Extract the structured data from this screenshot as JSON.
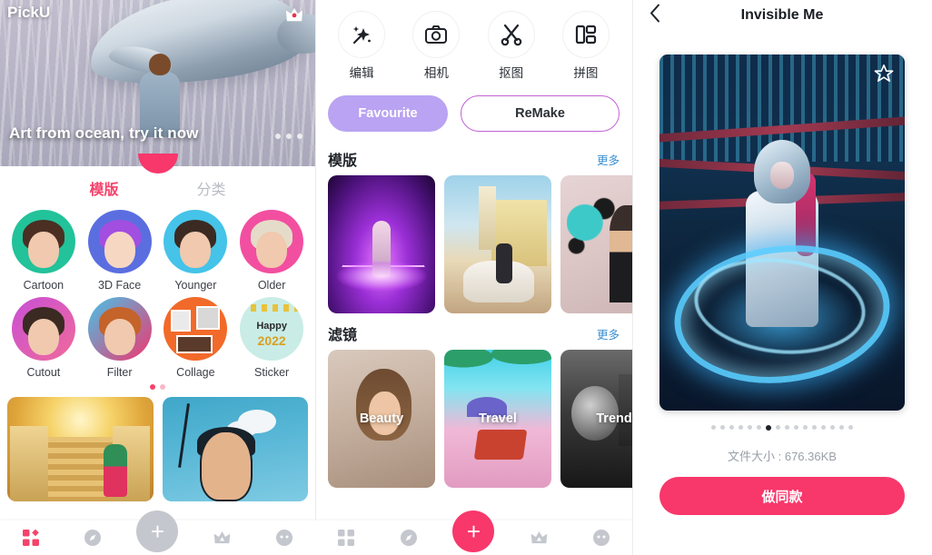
{
  "app": {
    "name": "PickU"
  },
  "left": {
    "logo": "PickU",
    "crown_icon": "crown-icon",
    "banner": {
      "title": "Art from ocean, try it now",
      "dots_count": 3,
      "active_dot": 0
    },
    "tabs": [
      {
        "label": "模版",
        "active": true
      },
      {
        "label": "分类",
        "active": false
      }
    ],
    "categories": [
      {
        "label": "Cartoon",
        "bg": "#22c29a"
      },
      {
        "label": "3D Face",
        "bg": "#5b6ee0"
      },
      {
        "label": "Younger",
        "bg": "#45c3e8"
      },
      {
        "label": "Older",
        "bg": "#f24fa0"
      },
      {
        "label": "Cutout",
        "bg": "#c84fd6"
      },
      {
        "label": "Filter",
        "bg": "#45c3e8"
      },
      {
        "label": "Collage",
        "bg": "#f26a2a"
      },
      {
        "label": "Sticker",
        "bg": "#bfe8e2"
      }
    ],
    "page_dots": {
      "count": 2,
      "active": 0
    },
    "promos": [
      {
        "name": "stairs-temple-template"
      },
      {
        "name": "comic-portrait-template"
      }
    ],
    "nav": [
      {
        "name": "grid-icon",
        "active": true
      },
      {
        "name": "compass-icon",
        "active": false
      },
      {
        "name": "plus-fab",
        "active": false,
        "style": "gray"
      },
      {
        "name": "crown-icon",
        "active": false
      },
      {
        "name": "smiley-icon",
        "active": false
      }
    ]
  },
  "middle": {
    "tools": [
      {
        "label": "编辑",
        "icon": "magic-wand-icon"
      },
      {
        "label": "相机",
        "icon": "camera-icon"
      },
      {
        "label": "抠图",
        "icon": "scissors-icon"
      },
      {
        "label": "拼图",
        "icon": "collage-grid-icon"
      }
    ],
    "pills": {
      "favourite": "Favourite",
      "remake": "ReMake"
    },
    "sections": [
      {
        "title": "模版",
        "more": "更多",
        "cards": [
          {
            "name": "neon-triangle-template"
          },
          {
            "name": "cuba-car-template"
          },
          {
            "name": "splash-portrait-template"
          }
        ]
      },
      {
        "title": "滤镜",
        "more": "更多",
        "cards": [
          {
            "name": "beauty-filter",
            "label": "Beauty"
          },
          {
            "name": "travel-filter",
            "label": "Travel"
          },
          {
            "name": "trend-filter",
            "label": "Trend"
          }
        ]
      }
    ],
    "nav": [
      {
        "name": "grid-icon",
        "active": false
      },
      {
        "name": "compass-icon",
        "active": false
      },
      {
        "name": "plus-fab",
        "active": true,
        "style": "pink"
      },
      {
        "name": "crown-icon",
        "active": false
      },
      {
        "name": "smiley-icon",
        "active": false
      }
    ]
  },
  "right": {
    "back_icon": "chevron-left-icon",
    "title": "Invisible Me",
    "favorite_icon": "star-outline-icon",
    "preview": {
      "name": "invisible-me-preview"
    },
    "dots": {
      "count": 16,
      "active": 6
    },
    "filesize": "文件大小 : 676.36KB",
    "cta": "做同款"
  },
  "colors": {
    "accent_pink": "#f8376b",
    "tab_active": "#f5436b",
    "favourite_purple": "#b9a3f2",
    "remake_border": "#c262d6",
    "more_link_blue": "#3a8ed0",
    "nav_inactive": "#c4c7cd",
    "page_bg": "#ffffff"
  }
}
